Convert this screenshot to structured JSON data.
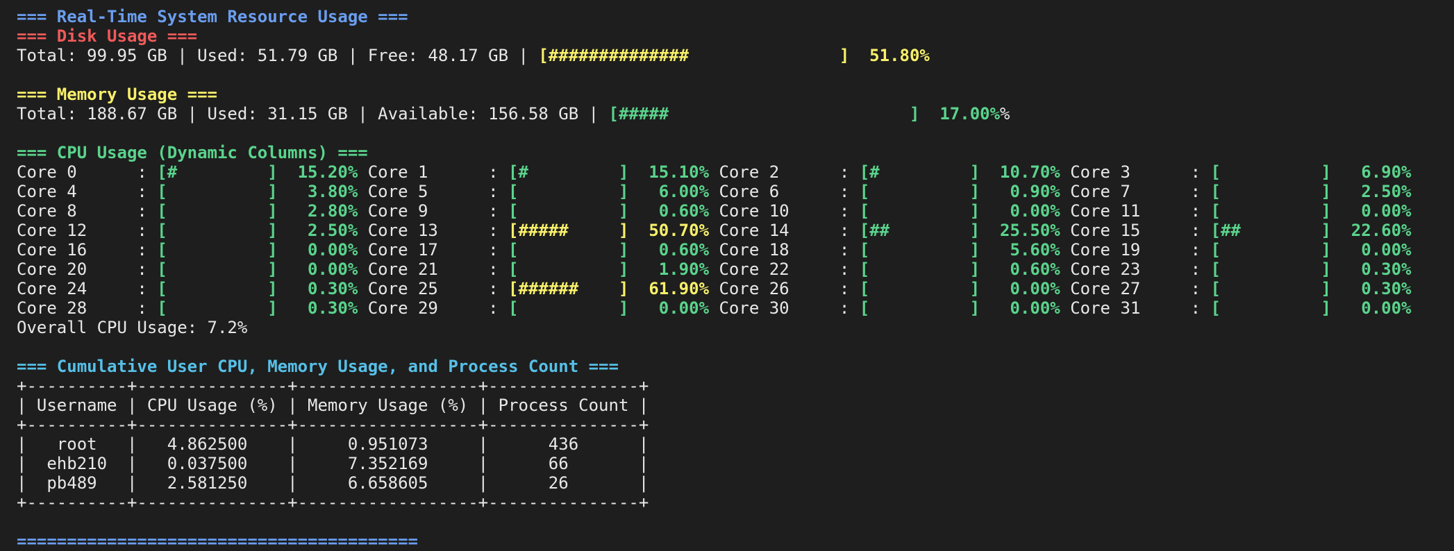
{
  "colors": {
    "background": "#1e1e1e",
    "text": "#e8e8e8",
    "blue": "#6a9ef0",
    "red": "#f05a5a",
    "yellow": "#f8f06a",
    "green": "#5ad48c",
    "cyan": "#56c0e8"
  },
  "lines": [
    [
      {
        "t": "=== Real-Time System Resource Usage ===",
        "c": "c-blue",
        "b": true
      }
    ],
    [
      {
        "t": "=== Disk Usage ===",
        "c": "c-red",
        "b": true
      }
    ],
    [
      {
        "t": "Total: 99.95 GB | Used: 51.79 GB | Free: 48.17 GB | ",
        "c": "c-white"
      },
      {
        "t": "[##############               ]  51.80%",
        "c": "c-yellow",
        "b": true
      }
    ],
    [],
    [
      {
        "t": "=== Memory Usage ===",
        "c": "c-yellow",
        "b": true
      }
    ],
    [
      {
        "t": "Total: 188.67 GB | Used: 31.15 GB | Available: 156.58 GB | ",
        "c": "c-white"
      },
      {
        "t": "[#####                        ]  17.00%",
        "c": "c-green",
        "b": true
      },
      {
        "t": "%",
        "c": "c-white"
      }
    ],
    [],
    [
      {
        "t": "=== CPU Usage (Dynamic Columns) ===",
        "c": "c-green",
        "b": true
      }
    ],
    [
      {
        "t": "Core 0      : ",
        "c": "c-white"
      },
      {
        "t": "[#         ]  15.20%",
        "c": "c-green",
        "b": true
      },
      {
        "t": " ",
        "c": "c-white"
      },
      {
        "t": "Core 1      : ",
        "c": "c-white"
      },
      {
        "t": "[#         ]  15.10%",
        "c": "c-green",
        "b": true
      },
      {
        "t": " ",
        "c": "c-white"
      },
      {
        "t": "Core 2      : ",
        "c": "c-white"
      },
      {
        "t": "[#         ]  10.70%",
        "c": "c-green",
        "b": true
      },
      {
        "t": " ",
        "c": "c-white"
      },
      {
        "t": "Core 3      : ",
        "c": "c-white"
      },
      {
        "t": "[          ]   6.90%",
        "c": "c-green",
        "b": true
      }
    ],
    [
      {
        "t": "Core 4      : ",
        "c": "c-white"
      },
      {
        "t": "[          ]   3.80%",
        "c": "c-green",
        "b": true
      },
      {
        "t": " ",
        "c": "c-white"
      },
      {
        "t": "Core 5      : ",
        "c": "c-white"
      },
      {
        "t": "[          ]   6.00%",
        "c": "c-green",
        "b": true
      },
      {
        "t": " ",
        "c": "c-white"
      },
      {
        "t": "Core 6      : ",
        "c": "c-white"
      },
      {
        "t": "[          ]   0.90%",
        "c": "c-green",
        "b": true
      },
      {
        "t": " ",
        "c": "c-white"
      },
      {
        "t": "Core 7      : ",
        "c": "c-white"
      },
      {
        "t": "[          ]   2.50%",
        "c": "c-green",
        "b": true
      }
    ],
    [
      {
        "t": "Core 8      : ",
        "c": "c-white"
      },
      {
        "t": "[          ]   2.80%",
        "c": "c-green",
        "b": true
      },
      {
        "t": " ",
        "c": "c-white"
      },
      {
        "t": "Core 9      : ",
        "c": "c-white"
      },
      {
        "t": "[          ]   0.60%",
        "c": "c-green",
        "b": true
      },
      {
        "t": " ",
        "c": "c-white"
      },
      {
        "t": "Core 10     : ",
        "c": "c-white"
      },
      {
        "t": "[          ]   0.00%",
        "c": "c-green",
        "b": true
      },
      {
        "t": " ",
        "c": "c-white"
      },
      {
        "t": "Core 11     : ",
        "c": "c-white"
      },
      {
        "t": "[          ]   0.00%",
        "c": "c-green",
        "b": true
      }
    ],
    [
      {
        "t": "Core 12     : ",
        "c": "c-white"
      },
      {
        "t": "[          ]   2.50%",
        "c": "c-green",
        "b": true
      },
      {
        "t": " ",
        "c": "c-white"
      },
      {
        "t": "Core 13     : ",
        "c": "c-white"
      },
      {
        "t": "[#####     ]  50.70%",
        "c": "c-yellow",
        "b": true
      },
      {
        "t": " ",
        "c": "c-white"
      },
      {
        "t": "Core 14     : ",
        "c": "c-white"
      },
      {
        "t": "[##        ]  25.50%",
        "c": "c-green",
        "b": true
      },
      {
        "t": " ",
        "c": "c-white"
      },
      {
        "t": "Core 15     : ",
        "c": "c-white"
      },
      {
        "t": "[##        ]  22.60%",
        "c": "c-green",
        "b": true
      }
    ],
    [
      {
        "t": "Core 16     : ",
        "c": "c-white"
      },
      {
        "t": "[          ]   0.00%",
        "c": "c-green",
        "b": true
      },
      {
        "t": " ",
        "c": "c-white"
      },
      {
        "t": "Core 17     : ",
        "c": "c-white"
      },
      {
        "t": "[          ]   0.60%",
        "c": "c-green",
        "b": true
      },
      {
        "t": " ",
        "c": "c-white"
      },
      {
        "t": "Core 18     : ",
        "c": "c-white"
      },
      {
        "t": "[          ]   5.60%",
        "c": "c-green",
        "b": true
      },
      {
        "t": " ",
        "c": "c-white"
      },
      {
        "t": "Core 19     : ",
        "c": "c-white"
      },
      {
        "t": "[          ]   0.00%",
        "c": "c-green",
        "b": true
      }
    ],
    [
      {
        "t": "Core 20     : ",
        "c": "c-white"
      },
      {
        "t": "[          ]   0.00%",
        "c": "c-green",
        "b": true
      },
      {
        "t": " ",
        "c": "c-white"
      },
      {
        "t": "Core 21     : ",
        "c": "c-white"
      },
      {
        "t": "[          ]   1.90%",
        "c": "c-green",
        "b": true
      },
      {
        "t": " ",
        "c": "c-white"
      },
      {
        "t": "Core 22     : ",
        "c": "c-white"
      },
      {
        "t": "[          ]   0.60%",
        "c": "c-green",
        "b": true
      },
      {
        "t": " ",
        "c": "c-white"
      },
      {
        "t": "Core 23     : ",
        "c": "c-white"
      },
      {
        "t": "[          ]   0.30%",
        "c": "c-green",
        "b": true
      }
    ],
    [
      {
        "t": "Core 24     : ",
        "c": "c-white"
      },
      {
        "t": "[          ]   0.30%",
        "c": "c-green",
        "b": true
      },
      {
        "t": " ",
        "c": "c-white"
      },
      {
        "t": "Core 25     : ",
        "c": "c-white"
      },
      {
        "t": "[######    ]  61.90%",
        "c": "c-yellow",
        "b": true
      },
      {
        "t": " ",
        "c": "c-white"
      },
      {
        "t": "Core 26     : ",
        "c": "c-white"
      },
      {
        "t": "[          ]   0.00%",
        "c": "c-green",
        "b": true
      },
      {
        "t": " ",
        "c": "c-white"
      },
      {
        "t": "Core 27     : ",
        "c": "c-white"
      },
      {
        "t": "[          ]   0.30%",
        "c": "c-green",
        "b": true
      }
    ],
    [
      {
        "t": "Core 28     : ",
        "c": "c-white"
      },
      {
        "t": "[          ]   0.30%",
        "c": "c-green",
        "b": true
      },
      {
        "t": " ",
        "c": "c-white"
      },
      {
        "t": "Core 29     : ",
        "c": "c-white"
      },
      {
        "t": "[          ]   0.00%",
        "c": "c-green",
        "b": true
      },
      {
        "t": " ",
        "c": "c-white"
      },
      {
        "t": "Core 30     : ",
        "c": "c-white"
      },
      {
        "t": "[          ]   0.00%",
        "c": "c-green",
        "b": true
      },
      {
        "t": " ",
        "c": "c-white"
      },
      {
        "t": "Core 31     : ",
        "c": "c-white"
      },
      {
        "t": "[          ]   0.00%",
        "c": "c-green",
        "b": true
      }
    ],
    [
      {
        "t": "Overall CPU Usage: 7.2%",
        "c": "c-white"
      }
    ],
    [],
    [
      {
        "t": "=== Cumulative User CPU, Memory Usage, and Process Count ===",
        "c": "c-cyan",
        "b": true
      }
    ],
    [
      {
        "t": "+----------+---------------+------------------+---------------+",
        "c": "c-white"
      }
    ],
    [
      {
        "t": "| Username | CPU Usage (%) | Memory Usage (%) | Process Count |",
        "c": "c-white"
      }
    ],
    [
      {
        "t": "+----------+---------------+------------------+---------------+",
        "c": "c-white"
      }
    ],
    [
      {
        "t": "|   root   |   4.862500    |     0.951073     |      436      |",
        "c": "c-white"
      }
    ],
    [
      {
        "t": "|  ehb210  |   0.037500    |     7.352169     |      66       |",
        "c": "c-white"
      }
    ],
    [
      {
        "t": "|  pb489   |   2.581250    |     6.658605     |      26       |",
        "c": "c-white"
      }
    ],
    [
      {
        "t": "+----------+---------------+------------------+---------------+",
        "c": "c-white"
      }
    ],
    [],
    [
      {
        "t": "========================================",
        "c": "c-blue",
        "b": true
      }
    ]
  ]
}
